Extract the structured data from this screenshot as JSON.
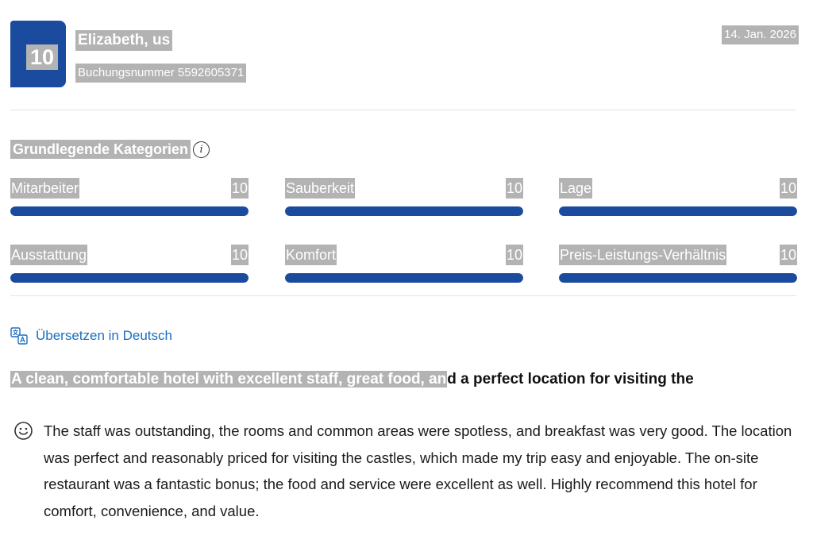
{
  "review": {
    "score": "10",
    "reviewer_name": "Elizabeth, us",
    "booking_number": "Buchungsnummer 5592605371",
    "date": "14. Jan. 2026",
    "categories_heading": "Grundlegende Kategorien",
    "categories": [
      {
        "label": "Mitarbeiter",
        "score": "10",
        "fill": 1.0
      },
      {
        "label": "Sauberkeit",
        "score": "10",
        "fill": 1.0
      },
      {
        "label": "Lage",
        "score": "10",
        "fill": 1.0
      },
      {
        "label": "Ausstattung",
        "score": "10",
        "fill": 1.0
      },
      {
        "label": "Komfort",
        "score": "10",
        "fill": 1.0
      },
      {
        "label": "Preis-Leistungs-Verhältnis",
        "score": "10",
        "fill": 1.0
      }
    ],
    "translate_link": "Übersetzen in Deutsch",
    "title_highlighted": "A clean, comfortable hotel with excellent staff, great food, an",
    "title_rest": "d a perfect location for visiting the",
    "body": "The staff was outstanding, the rooms and common areas were spotless, and breakfast was very good. The location was perfect and reasonably priced for visiting the castles, which made my trip easy and enjoyable. The on-site restaurant was a fantastic bonus; the food and service were excellent as well. Highly recommend this hotel for comfort, convenience, and value."
  },
  "icons": {
    "info": "info-icon",
    "translate": "translate-icon",
    "smile": "smile-icon"
  },
  "colors": {
    "accent": "#1b4b9e",
    "link": "#1a6fc2",
    "highlight": "#b3b3b3"
  }
}
